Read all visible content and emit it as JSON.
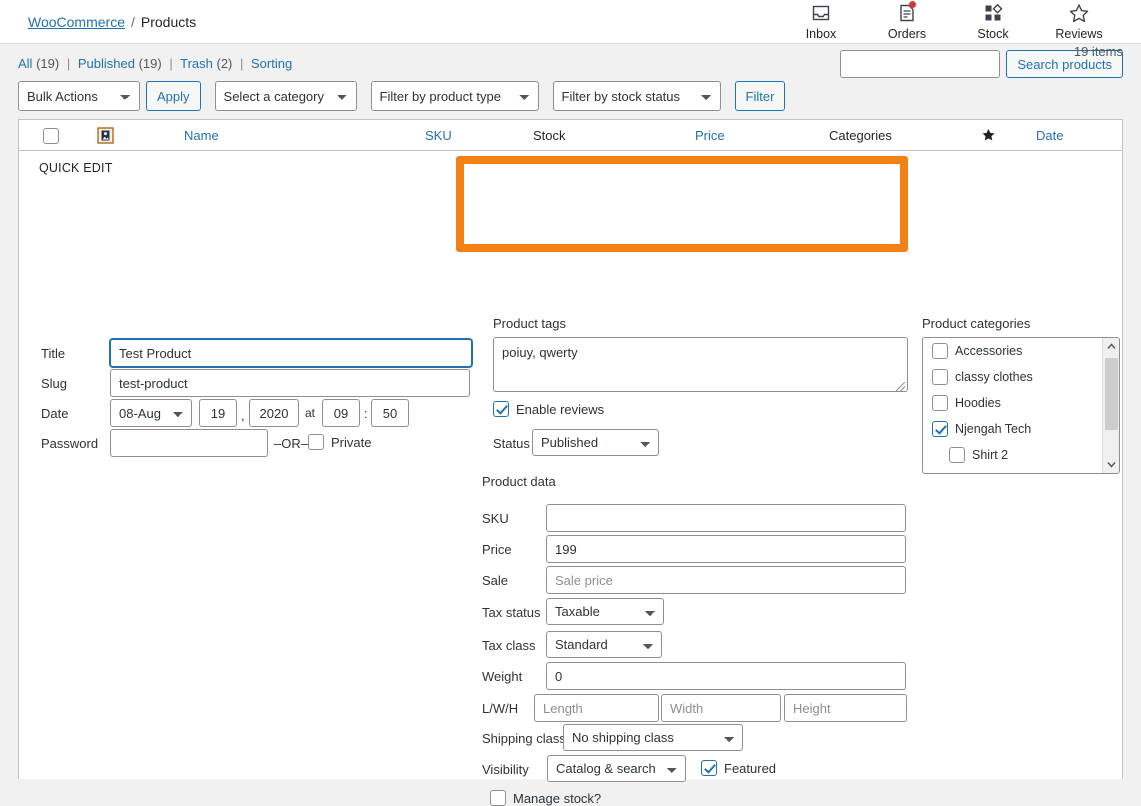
{
  "breadcrumb": {
    "root": "WooCommerce",
    "separator": "/",
    "current": "Products"
  },
  "topnav": [
    {
      "label": "Inbox",
      "icon": "inbox-icon",
      "badge": false
    },
    {
      "label": "Orders",
      "icon": "orders-icon",
      "badge": true
    },
    {
      "label": "Stock",
      "icon": "stock-icon",
      "badge": false
    },
    {
      "label": "Reviews",
      "icon": "reviews-star-icon",
      "badge": false
    }
  ],
  "status_links": [
    {
      "label": "All",
      "count": "(19)"
    },
    {
      "label": "Published",
      "count": "(19)"
    },
    {
      "label": "Trash",
      "count": "(2)"
    },
    {
      "label": "Sorting",
      "count": ""
    }
  ],
  "search": {
    "value": "",
    "placeholder": "",
    "button": "Search products"
  },
  "items_count": "19 items",
  "toolbar": {
    "bulk_actions": "Bulk Actions",
    "apply": "Apply",
    "category": "Select a category",
    "product_type": "Filter by product type",
    "stock_status": "Filter by stock status",
    "filter": "Filter"
  },
  "table_headers": {
    "image": "image-icon",
    "name": "Name",
    "sku": "SKU",
    "stock": "Stock",
    "price": "Price",
    "categories": "Categories",
    "featured": "star-icon",
    "date": "Date"
  },
  "quick_edit": {
    "heading": "QUICK EDIT",
    "title_label": "Title",
    "title_value": "Test Product",
    "slug_label": "Slug",
    "slug_value": "test-product",
    "date_label": "Date",
    "date_month": "08-Aug",
    "date_day": "19",
    "date_comma": ",",
    "date_year": "2020",
    "date_at": "at",
    "date_hour": "09",
    "date_colon": ":",
    "date_minute": "50",
    "password_label": "Password",
    "password_value": "",
    "or_text": "–OR–",
    "private_label": "Private",
    "private_checked": false
  },
  "product_tags": {
    "label": "Product tags",
    "value": "poiuy, qwerty"
  },
  "reviews": {
    "label": "Enable reviews",
    "checked": true
  },
  "status": {
    "label": "Status",
    "value": "Published"
  },
  "product_categories": {
    "label": "Product categories",
    "items": [
      {
        "label": "Accessories",
        "checked": false,
        "child": false
      },
      {
        "label": "classy clothes",
        "checked": false,
        "child": false
      },
      {
        "label": "Hoodies",
        "checked": false,
        "child": false
      },
      {
        "label": "Njengah Tech",
        "checked": true,
        "child": false
      },
      {
        "label": "Shirt 2",
        "checked": false,
        "child": true
      }
    ]
  },
  "product_data": {
    "heading": "Product data",
    "sku_label": "SKU",
    "sku_value": "",
    "price_label": "Price",
    "price_value": "199",
    "sale_label": "Sale",
    "sale_placeholder": "Sale price",
    "tax_status_label": "Tax status",
    "tax_status_value": "Taxable",
    "tax_class_label": "Tax class",
    "tax_class_value": "Standard",
    "weight_label": "Weight",
    "weight_value": "0",
    "lwh_label": "L/W/H",
    "length_placeholder": "Length",
    "width_placeholder": "Width",
    "height_placeholder": "Height",
    "shipping_class_label": "Shipping class",
    "shipping_class_value": "No shipping class",
    "visibility_label": "Visibility",
    "visibility_value": "Catalog & search",
    "featured_label": "Featured",
    "featured_checked": true,
    "manage_stock_label": "Manage stock?",
    "manage_stock_checked": false
  },
  "colors": {
    "link": "#2271b1",
    "highlight": "#f28014",
    "badge": "#d63638"
  }
}
